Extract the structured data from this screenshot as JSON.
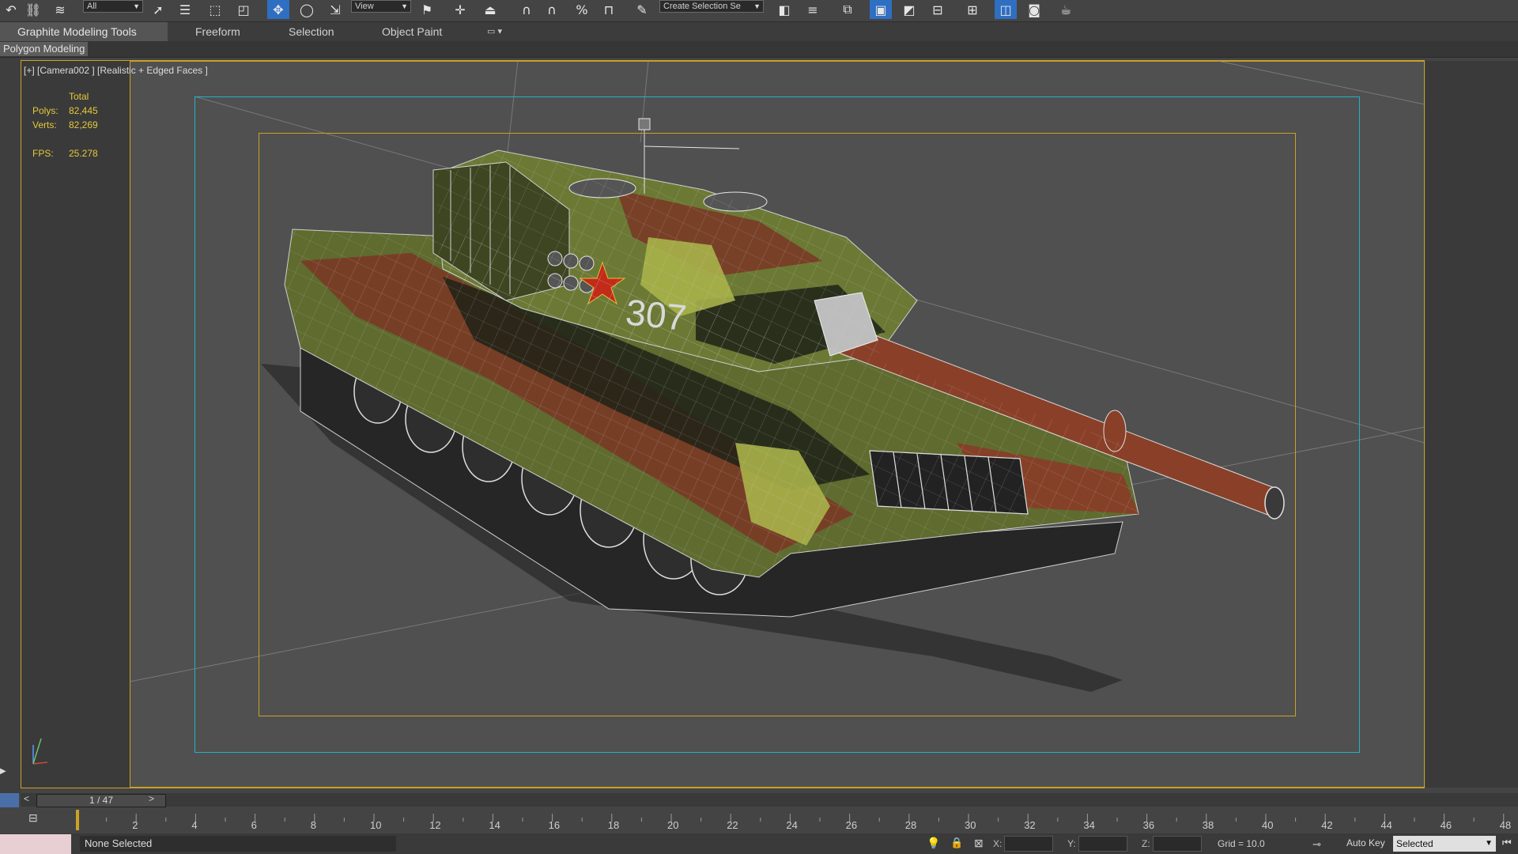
{
  "toolbar": {
    "selection_filter": "All",
    "ref_coord": "View",
    "named_selection": "Create Selection Se",
    "icons": [
      "undo-icon",
      "redo-icon",
      "link-icon",
      "unlink-icon",
      "bind-space-warp-icon",
      "select-object-icon",
      "select-by-name-icon",
      "rectangle-region-icon",
      "window-crossing-icon",
      "select-move-icon",
      "select-rotate-icon",
      "select-scale-icon",
      "select-manipulate-icon",
      "keyboard-shortcut-icon",
      "snap-toggle-icon",
      "angle-snap-icon",
      "percent-snap-icon",
      "spinner-snap-icon",
      "edit-named-selection-icon",
      "mirror-icon",
      "align-icon",
      "layer-manager-icon",
      "graphite-toggle-icon",
      "curve-editor-icon",
      "schematic-view-icon",
      "material-editor-icon",
      "render-setup-icon",
      "rendered-frame-icon",
      "render-icon"
    ]
  },
  "ribbon": {
    "tabs": [
      "Graphite Modeling Tools",
      "Freeform",
      "Selection",
      "Object Paint"
    ],
    "active_tab": "Graphite Modeling Tools",
    "panel_label": "Polygon Modeling"
  },
  "viewport": {
    "label": "[+] [Camera002 ] [Realistic + Edged Faces ]",
    "stats": {
      "header": "Total",
      "polys_label": "Polys:",
      "polys_value": "82,445",
      "verts_label": "Verts:",
      "verts_value": "82,269",
      "fps_label": "FPS:",
      "fps_value": "25.278"
    },
    "model_text": "307"
  },
  "time_slider": {
    "label": "1 / 47",
    "prev": "<",
    "next": ">",
    "frame_current": 1,
    "frame_total": 47
  },
  "trackbar": {
    "ticks": [
      "2",
      "4",
      "6",
      "8",
      "10",
      "12",
      "14",
      "16",
      "18",
      "20",
      "22",
      "24",
      "26",
      "28",
      "30",
      "32",
      "34",
      "36",
      "38",
      "40",
      "42",
      "44",
      "46",
      "48"
    ]
  },
  "status": {
    "selection": "None Selected",
    "x_label": "X:",
    "y_label": "Y:",
    "z_label": "Z:",
    "grid": "Grid = 10.0",
    "autokey": "Auto Key",
    "key_mode": "Selected"
  },
  "colors": {
    "frame_gold": "#c9a227",
    "safe_frame_cyan": "#1fb3c7",
    "active_blue": "#2f6fc2",
    "stats_yellow": "#e3c93a",
    "camo_green": "#7e8f3a",
    "camo_brown": "#7a3a26"
  }
}
